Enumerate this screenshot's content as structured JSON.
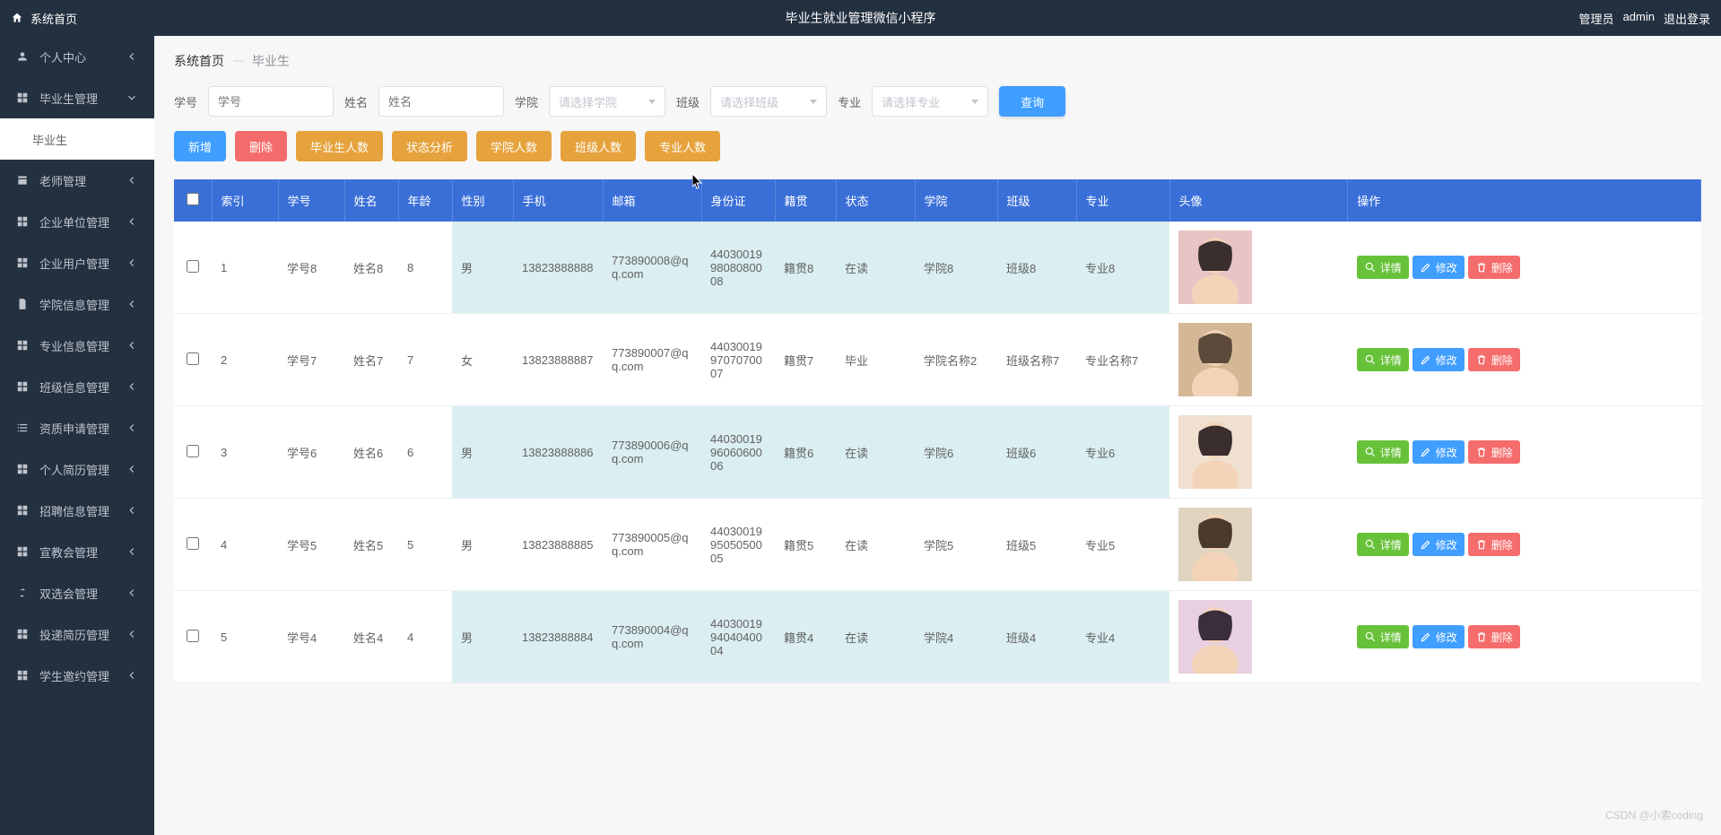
{
  "header": {
    "home": "系统首页",
    "title": "毕业生就业管理微信小程序",
    "role": "管理员",
    "user": "admin",
    "logout": "退出登录"
  },
  "sidebar": {
    "items": [
      {
        "icon": "person",
        "label": "个人中心",
        "expandable": true
      },
      {
        "icon": "grid",
        "label": "毕业生管理",
        "expandable": true,
        "expanded": true
      },
      {
        "icon": "",
        "label": "毕业生",
        "sub": true,
        "active": true
      },
      {
        "icon": "badge",
        "label": "老师管理",
        "expandable": true
      },
      {
        "icon": "grid",
        "label": "企业单位管理",
        "expandable": true
      },
      {
        "icon": "grid",
        "label": "企业用户管理",
        "expandable": true
      },
      {
        "icon": "doc",
        "label": "学院信息管理",
        "expandable": true
      },
      {
        "icon": "grid",
        "label": "专业信息管理",
        "expandable": true
      },
      {
        "icon": "grid",
        "label": "班级信息管理",
        "expandable": true
      },
      {
        "icon": "list",
        "label": "资质申请管理",
        "expandable": true
      },
      {
        "icon": "grid",
        "label": "个人简历管理",
        "expandable": true
      },
      {
        "icon": "grid",
        "label": "招聘信息管理",
        "expandable": true
      },
      {
        "icon": "grid",
        "label": "宣教会管理",
        "expandable": true
      },
      {
        "icon": "swap",
        "label": "双选会管理",
        "expandable": true
      },
      {
        "icon": "grid",
        "label": "投递简历管理",
        "expandable": true
      },
      {
        "icon": "grid",
        "label": "学生邀约管理",
        "expandable": true
      }
    ]
  },
  "breadcrumb": {
    "home": "系统首页",
    "current": "毕业生"
  },
  "search": {
    "l1": "学号",
    "ph1": "学号",
    "l2": "姓名",
    "ph2": "姓名",
    "l3": "学院",
    "ph3": "请选择学院",
    "l4": "班级",
    "ph4": "请选择班级",
    "l5": "专业",
    "ph5": "请选择专业",
    "query": "查询"
  },
  "toolbar": {
    "add": "新增",
    "del": "删除",
    "count": "毕业生人数",
    "status": "状态分析",
    "college": "学院人数",
    "class": "班级人数",
    "major": "专业人数"
  },
  "columns": [
    "索引",
    "学号",
    "姓名",
    "年龄",
    "性别",
    "手机",
    "邮箱",
    "身份证",
    "籍贯",
    "状态",
    "学院",
    "班级",
    "专业",
    "头像",
    "操作"
  ],
  "ops": {
    "detail": "详情",
    "edit": "修改",
    "delete": "删除"
  },
  "rows": [
    {
      "idx": "1",
      "sno": "学号8",
      "name": "姓名8",
      "age": "8",
      "gender": "男",
      "phone": "13823888888",
      "email": "773890008@qq.com",
      "idcard": "440300199808080008",
      "origin": "籍贯8",
      "status": "在读",
      "college": "学院8",
      "class": "班级8",
      "major": "专业8"
    },
    {
      "idx": "2",
      "sno": "学号7",
      "name": "姓名7",
      "age": "7",
      "gender": "女",
      "phone": "13823888887",
      "email": "773890007@qq.com",
      "idcard": "440300199707070007",
      "origin": "籍贯7",
      "status": "毕业",
      "college": "学院名称2",
      "class": "班级名称7",
      "major": "专业名称7"
    },
    {
      "idx": "3",
      "sno": "学号6",
      "name": "姓名6",
      "age": "6",
      "gender": "男",
      "phone": "13823888886",
      "email": "773890006@qq.com",
      "idcard": "440300199606060006",
      "origin": "籍贯6",
      "status": "在读",
      "college": "学院6",
      "class": "班级6",
      "major": "专业6"
    },
    {
      "idx": "4",
      "sno": "学号5",
      "name": "姓名5",
      "age": "5",
      "gender": "男",
      "phone": "13823888885",
      "email": "773890005@qq.com",
      "idcard": "440300199505050005",
      "origin": "籍贯5",
      "status": "在读",
      "college": "学院5",
      "class": "班级5",
      "major": "专业5"
    },
    {
      "idx": "5",
      "sno": "学号4",
      "name": "姓名4",
      "age": "4",
      "gender": "男",
      "phone": "13823888884",
      "email": "773890004@qq.com",
      "idcard": "440300199404040004",
      "origin": "籍贯4",
      "status": "在读",
      "college": "学院4",
      "class": "班级4",
      "major": "专业4"
    }
  ],
  "watermark": "CSDN @小索coding"
}
